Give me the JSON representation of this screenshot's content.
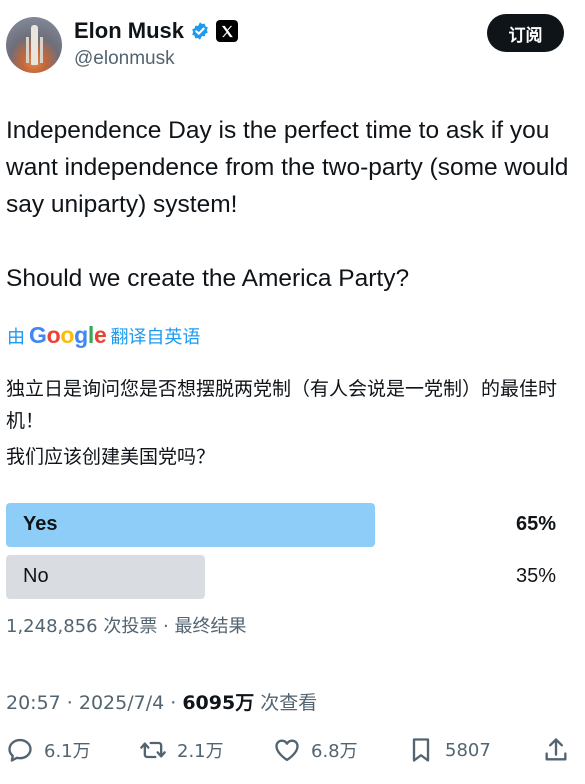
{
  "header": {
    "display_name": "Elon Musk",
    "handle": "@elonmusk",
    "subscribe_label": "订阅",
    "icons": [
      "avatar",
      "verified-badge-icon",
      "x-logo-icon"
    ]
  },
  "tweet": {
    "paragraphs": [
      "Independence Day is the perfect time to ask if you want independence from the two-party (some would say uniparty) system!",
      "Should we create the America Party?"
    ]
  },
  "translation": {
    "prefix": "由",
    "provider": "Google",
    "suffix": "翻译自英语",
    "lines": [
      "独立日是询问您是否想摆脱两党制（有人会说是一党制）的最佳时机！",
      "我们应该创建美国党吗？"
    ]
  },
  "poll": {
    "options": [
      {
        "label": "Yes",
        "percent_text": "65%",
        "percent": 65,
        "winner": true
      },
      {
        "label": "No",
        "percent_text": "35%",
        "percent": 35,
        "winner": false
      }
    ],
    "meta": "1,248,856 次投票 · 最终结果"
  },
  "timestamp": {
    "time": "20:57 · 2025/7/4 · ",
    "views": "6095万",
    "views_suffix": " 次查看"
  },
  "actions": {
    "reply": "6.1万",
    "retweet": "2.1万",
    "like": "6.8万",
    "bookmark": "5807"
  },
  "colors": {
    "accent": "#1d9bf0",
    "poll_winner": "#8ecdf8",
    "poll_other": "#d9dde1",
    "secondary_text": "#536471"
  }
}
